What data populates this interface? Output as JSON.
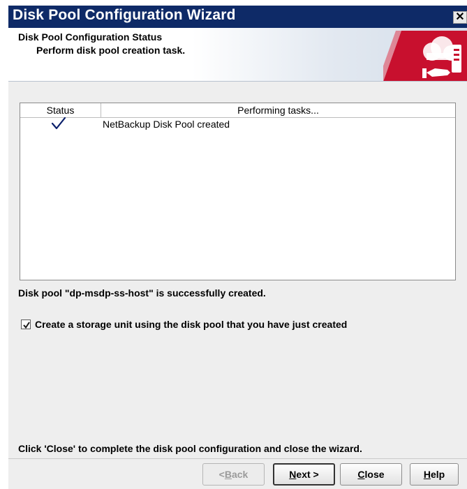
{
  "window": {
    "title": "Disk Pool Configuration Wizard",
    "close_glyph": "✕"
  },
  "header": {
    "title": "Disk Pool Configuration Status",
    "subtitle": "Perform disk pool creation task.",
    "logo_icon": "netbackup-cloud-icon",
    "accent_color": "#c8102e"
  },
  "table": {
    "columns": [
      "Status",
      "Performing tasks..."
    ],
    "rows": [
      {
        "status_icon": "checkmark-icon",
        "task": "NetBackup Disk Pool created"
      }
    ]
  },
  "message": "Disk pool \"dp-msdp-ss-host\" is successfully created.",
  "storage_unit_checkbox": {
    "checked": true,
    "label": "Create a storage unit using the disk pool that you have just created"
  },
  "footer_message": "Click 'Close' to complete the disk pool configuration and close the wizard.",
  "buttons": {
    "back": {
      "label": "< Back",
      "mnemonic_prefix": "< ",
      "mnemonic": "B",
      "rest": "ack",
      "enabled": false
    },
    "next": {
      "label": "Next >",
      "mnemonic": "N",
      "rest": "ext >",
      "enabled": true
    },
    "close": {
      "label": "Close",
      "mnemonic": "C",
      "rest": "lose",
      "enabled": true
    },
    "help": {
      "label": "Help",
      "mnemonic": "H",
      "rest": "elp",
      "enabled": true
    }
  }
}
